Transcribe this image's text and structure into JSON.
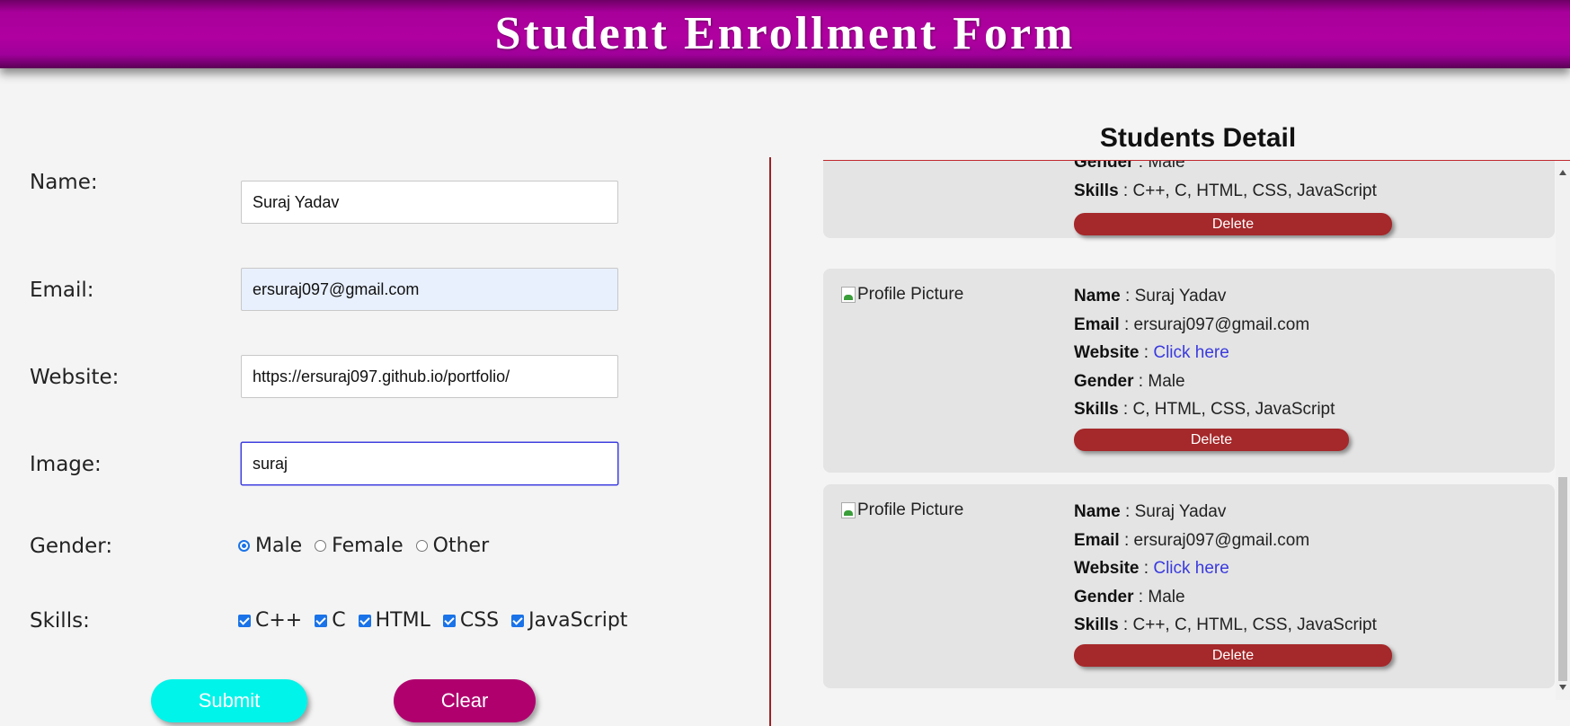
{
  "header": {
    "title": "Student Enrollment Form"
  },
  "form": {
    "name_label": "Name:",
    "name_value": "Suraj Yadav",
    "email_label": "Email:",
    "email_value": "ersuraj097@gmail.com",
    "website_label": "Website:",
    "website_value": "https://ersuraj097.github.io/portfolio/",
    "image_label": "Image:",
    "image_value": "suraj",
    "gender_label": "Gender:",
    "gender_options": [
      "Male",
      "Female",
      "Other"
    ],
    "gender_selected": "Male",
    "skills_label": "Skills:",
    "skills_options": [
      "C++",
      "C",
      "HTML",
      "CSS",
      "JavaScript"
    ],
    "skills_checked": [
      "C++",
      "C",
      "HTML",
      "CSS",
      "JavaScript"
    ],
    "submit_label": "Submit",
    "clear_label": "Clear"
  },
  "details": {
    "title": "Students Detail",
    "field_names": {
      "name": "Name",
      "email": "Email",
      "website": "Website",
      "gender": "Gender",
      "skills": "Skills"
    },
    "separator": " : ",
    "picture_alt": "Profile Picture",
    "link_text": "Click here",
    "delete_label": "Delete",
    "cards": [
      {
        "gender": "Male",
        "skills": "C++, C, HTML, CSS, JavaScript"
      },
      {
        "name": "Suraj Yadav",
        "email": "ersuraj097@gmail.com",
        "gender": "Male",
        "skills": "C, HTML, CSS, JavaScript"
      },
      {
        "name": "Suraj Yadav",
        "email": "ersuraj097@gmail.com",
        "gender": "Male",
        "skills": "C++, C, HTML, CSS, JavaScript"
      }
    ]
  }
}
